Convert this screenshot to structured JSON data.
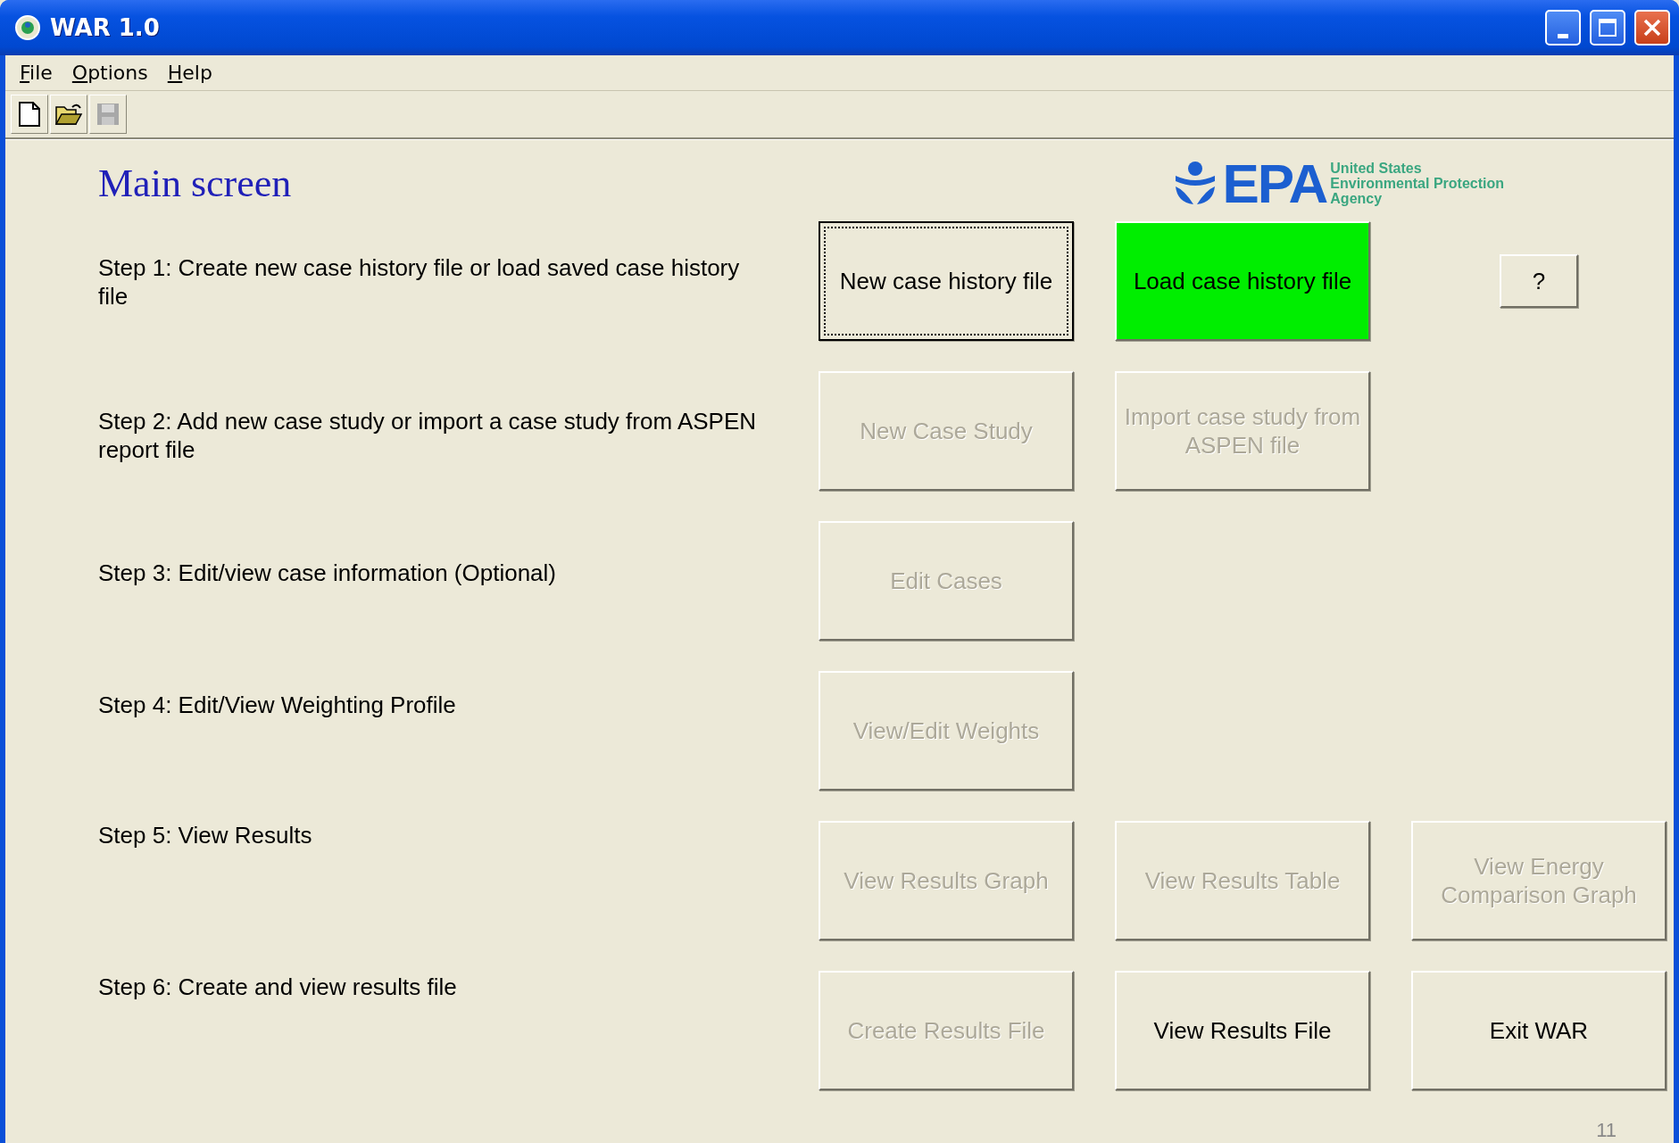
{
  "window": {
    "title": "WAR 1.0"
  },
  "menu": [
    {
      "label": "File"
    },
    {
      "label": "Options"
    },
    {
      "label": "Help"
    }
  ],
  "toolbar": [
    {
      "kind": "new",
      "disabled": false
    },
    {
      "kind": "open",
      "disabled": false
    },
    {
      "kind": "save",
      "disabled": true
    }
  ],
  "heading": "Main screen",
  "logo": {
    "wordmark": "EPA",
    "lines": [
      "United States",
      "Environmental Protection",
      "Agency"
    ]
  },
  "steps": [
    {
      "label": "Step 1: Create new case history file or load saved case history file",
      "buttons": [
        {
          "label": "New case history file",
          "disabled": false,
          "focused": true
        },
        {
          "label": "Load case history file",
          "disabled": false,
          "focused": false,
          "color": "#00ee00"
        },
        {
          "label": "?",
          "disabled": false,
          "focused": false,
          "kind": "small"
        }
      ]
    },
    {
      "label": "Step 2: Add new case study or import a case study from ASPEN report file",
      "buttons": [
        {
          "label": "New Case Study",
          "disabled": true,
          "focused": false
        },
        {
          "label": "Import case study from ASPEN file",
          "disabled": true,
          "focused": false
        }
      ]
    },
    {
      "label": "Step 3: Edit/view case information (Optional)",
      "buttons": [
        {
          "label": "Edit Cases",
          "disabled": true,
          "focused": false
        }
      ]
    },
    {
      "label": "Step 4: Edit/View Weighting Profile",
      "buttons": [
        {
          "label": "View/Edit Weights",
          "disabled": true,
          "focused": false
        }
      ]
    },
    {
      "label": "Step 5: View Results",
      "buttons": [
        {
          "label": "View Results Graph",
          "disabled": true,
          "focused": false
        },
        {
          "label": "View Results Table",
          "disabled": true,
          "focused": false
        },
        {
          "label": "View Energy Comparison Graph",
          "disabled": true,
          "focused": false
        }
      ]
    },
    {
      "label": "Step 6: Create and view results file",
      "buttons": [
        {
          "label": "Create Results File",
          "disabled": true,
          "focused": false
        },
        {
          "label": "View Results File",
          "disabled": false,
          "focused": false
        },
        {
          "label": "Exit WAR",
          "disabled": false,
          "focused": false
        }
      ]
    }
  ],
  "slide_number": "11"
}
